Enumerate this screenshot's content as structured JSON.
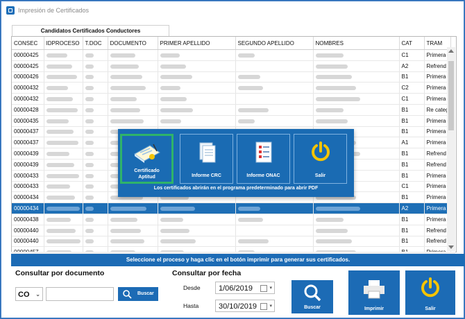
{
  "window": {
    "title": "Impresión de Certificados"
  },
  "tab": {
    "label": "Candidatos Certificados Conductores"
  },
  "grid": {
    "columns": [
      "CONSEC",
      "IDPROCESO",
      "T.DOC",
      "DOCUMENTO",
      "PRIMER APELLIDO",
      "SEGUNDO APELLIDO",
      "NOMBRES",
      "CAT",
      "TRAM"
    ],
    "rows": [
      {
        "consec": "00000425",
        "cat": "C1",
        "tram": "Primera"
      },
      {
        "consec": "00000425",
        "cat": "A2",
        "tram": "Refrend"
      },
      {
        "consec": "00000426",
        "cat": "B1",
        "tram": "Primera"
      },
      {
        "consec": "00000432",
        "cat": "C2",
        "tram": "Primera"
      },
      {
        "consec": "00000432",
        "cat": "C1",
        "tram": "Primera"
      },
      {
        "consec": "00000428",
        "cat": "B1",
        "tram": "Re categ"
      },
      {
        "consec": "00000435",
        "cat": "B1",
        "tram": "Primera"
      },
      {
        "consec": "00000437",
        "cat": "B1",
        "tram": "Primera"
      },
      {
        "consec": "00000437",
        "cat": "A1",
        "tram": "Primera"
      },
      {
        "consec": "00000439",
        "cat": "B1",
        "tram": "Refrend"
      },
      {
        "consec": "00000439",
        "cat": "B1",
        "tram": "Refrend"
      },
      {
        "consec": "00000433",
        "cat": "B1",
        "tram": "Primera"
      },
      {
        "consec": "00000433",
        "cat": "C1",
        "tram": "Primera"
      },
      {
        "consec": "00000434",
        "cat": "B1",
        "tram": "Primera"
      },
      {
        "consec": "00000434",
        "cat": "A2",
        "tram": "Primera"
      },
      {
        "consec": "00000438",
        "cat": "B1",
        "tram": "Primera"
      },
      {
        "consec": "00000440",
        "cat": "B1",
        "tram": "Refrend"
      },
      {
        "consec": "00000440",
        "cat": "B1",
        "tram": "Refrend"
      },
      {
        "consec": "00000457",
        "cat": "B1",
        "tram": "Primera"
      }
    ]
  },
  "popup": {
    "buttons": [
      {
        "label": "Certificado\nAptitud"
      },
      {
        "label": "Informe CRC"
      },
      {
        "label": "Informe ONAC"
      },
      {
        "label": "Salir"
      }
    ],
    "note": "Los certificados abrirán en el programa predeterminado para abrir PDF"
  },
  "instruction": "Seleccione el proceso y haga clic en el botón imprimir para generar sus certificados.",
  "by_document": {
    "title": "Consultar por documento",
    "doc_type": "CO",
    "document_value": "",
    "search_label": "Buscar"
  },
  "by_date": {
    "title": "Consultar por fecha",
    "from_label": "Desde",
    "from_value": "1/06/2019",
    "to_label": "Hasta",
    "to_value": "30/10/2019",
    "search_label": "Buscar"
  },
  "actions": {
    "print_label": "Imprimir",
    "exit_label": "Salir"
  },
  "colors": {
    "accent": "#1c6bb5",
    "selected_row": "#1e6fb6",
    "active_border": "#2fb36a",
    "icon_yellow": "#f5c400"
  },
  "icons": [
    "app-icon",
    "certificate-icon",
    "document-report-icon",
    "checklist-report-icon",
    "power-icon",
    "search-icon",
    "printer-icon"
  ]
}
